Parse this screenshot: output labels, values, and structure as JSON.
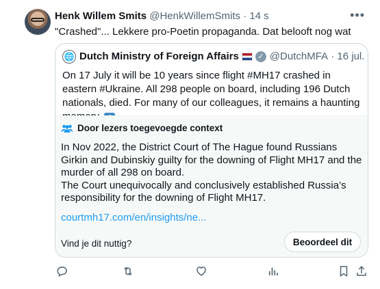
{
  "tweet": {
    "author_name": "Henk Willem Smits",
    "author_handle": "@HenkWillemSmits",
    "time": "· 14 s",
    "text": "\"Crashed\"... Lekkere pro-Poetin propaganda. Dat belooft nog wat",
    "more_icon": "more-icon"
  },
  "quote": {
    "author_name": "Dutch Ministry of Foreign Affairs",
    "author_handle": "@DutchMFA",
    "date": "· 16 jul.",
    "text": "On 17 July it will be 10 years since flight #MH17 crashed in eastern #Ukraine. All 298 people on board, including 196 Dutch nationals, died. For many of our colleagues, it remains a haunting memory.",
    "emoji": "⬇"
  },
  "community_note": {
    "title": "Door lezers toegevoegde context",
    "paragraph1": "In Nov 2022, the District Court of The Hague found Russians Girkin and Dubinskiy guilty for the downing of Flight MH17 and the murder of all 298 on board.",
    "paragraph2": "The Court unequivocally and conclusively established Russia’s responsibility for the downing of Flight MH17.",
    "link": "courtmh17.com/en/insights/ne...",
    "question": "Vind je dit nuttig?",
    "rate_button": "Beoordeel dit"
  },
  "actions": [
    "reply-icon",
    "retweet-icon",
    "like-icon",
    "views-icon",
    "bookmark-icon",
    "share-icon"
  ],
  "colors": {
    "link": "#1d9bf0",
    "muted": "#536471",
    "border": "#cfd9de",
    "note_bg": "#f7f9f9"
  }
}
